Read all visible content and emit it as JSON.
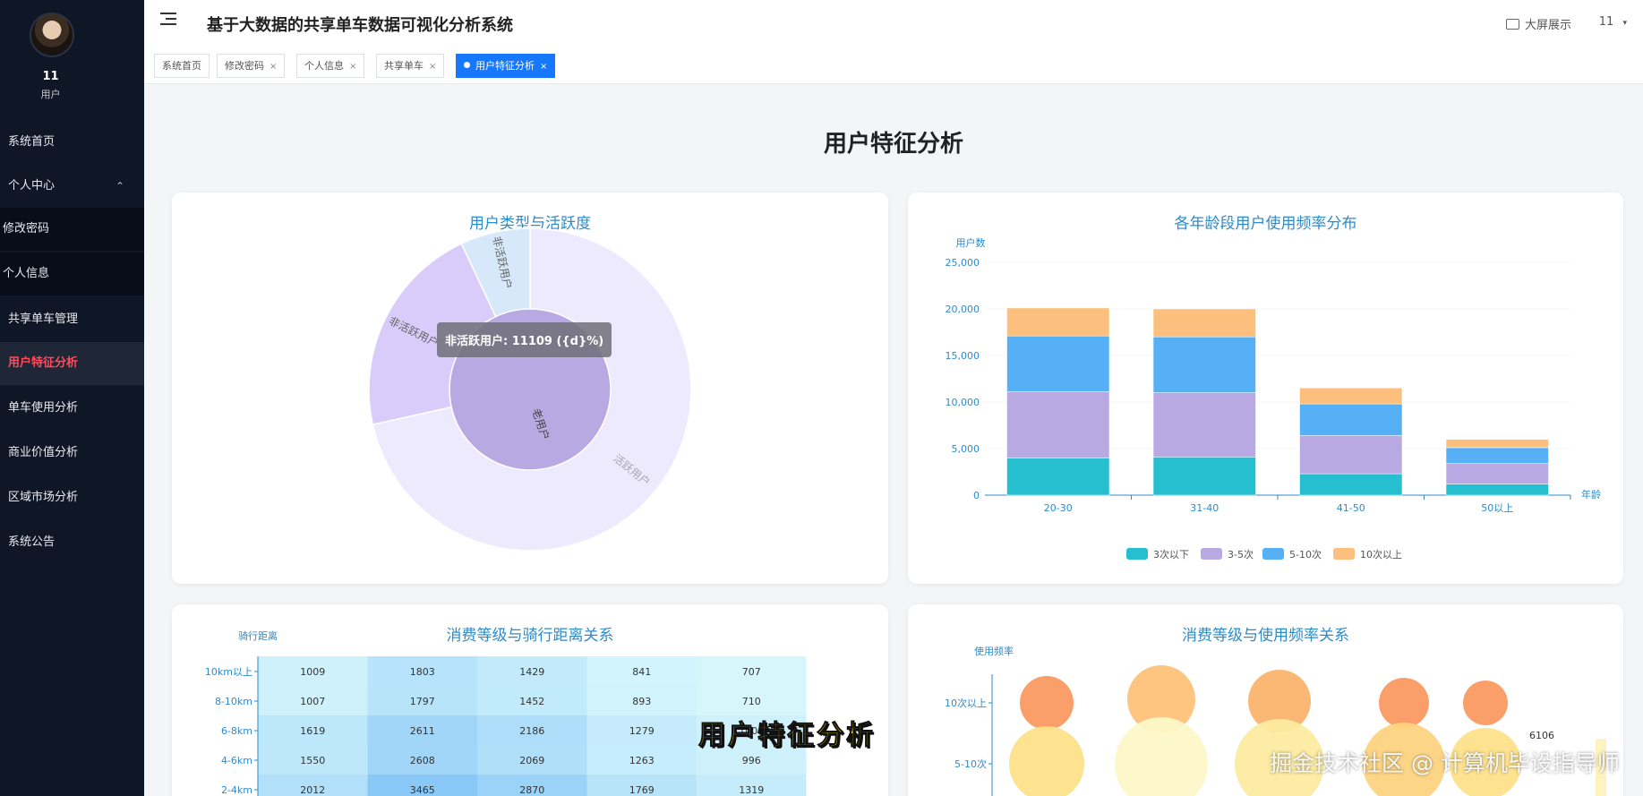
{
  "sidebar": {
    "user_name": "11",
    "user_role": "用户",
    "items": [
      {
        "label": "系统首页"
      },
      {
        "label": "个人中心"
      },
      {
        "label": "修改密码"
      },
      {
        "label": "个人信息"
      },
      {
        "label": "共享单车管理"
      },
      {
        "label": "用户特征分析"
      },
      {
        "label": "单车使用分析"
      },
      {
        "label": "商业价值分析"
      },
      {
        "label": "区域市场分析"
      },
      {
        "label": "系统公告"
      }
    ]
  },
  "header": {
    "title": "基于大数据的共享单车数据可视化分析系统",
    "bigscreen_label": "大屏展示",
    "user_label": "11",
    "tabs": [
      {
        "label": "系统首页"
      },
      {
        "label": "修改密码"
      },
      {
        "label": "个人信息"
      },
      {
        "label": "共享单车"
      },
      {
        "label": "用户特征分析"
      }
    ]
  },
  "main": {
    "heading": "用户特征分析",
    "caption": "用户特征分析",
    "watermark": "掘金技术社区 @ 计算机毕设指导师"
  },
  "colors": {
    "accent": "#1677ff",
    "sidebar_bg": "#0f1727",
    "active_nav": "#ff4b5c"
  },
  "chart_data": [
    {
      "type": "pie",
      "title": "用户类型与活跃度",
      "inner": [
        {
          "name": "老用户",
          "value": 1
        }
      ],
      "outer": [
        {
          "name": "活跃用户",
          "value": 0.715
        },
        {
          "name": "非活跃用户",
          "value": 0.215
        },
        {
          "name": "非活跃用户",
          "value": 0.07
        }
      ],
      "tooltip": "非活跃用户: 11109 ({d}%)"
    },
    {
      "type": "bar",
      "title": "各年龄段用户使用频率分布",
      "ylabel": "用户数",
      "xlabel": "年龄",
      "ylim": [
        0,
        25000
      ],
      "yticks": [
        "0",
        "5,000",
        "10,000",
        "15,000",
        "20,000",
        "25,000"
      ],
      "categories": [
        "20-30",
        "31-40",
        "41-50",
        "50以上"
      ],
      "series": [
        {
          "name": "3次以下",
          "color": "#26bfd0",
          "values": [
            4000,
            4100,
            2300,
            1200
          ]
        },
        {
          "name": "3-5次",
          "color": "#b8a9e3",
          "values": [
            7100,
            6900,
            4100,
            2200
          ]
        },
        {
          "name": "5-10次",
          "color": "#55b0f5",
          "values": [
            6000,
            6000,
            3400,
            1700
          ]
        },
        {
          "name": "10次以上",
          "color": "#fcbf7d",
          "values": [
            3000,
            3000,
            1700,
            900
          ]
        }
      ],
      "stacked": true,
      "legend": "bottom"
    },
    {
      "type": "heatmap",
      "title": "消费等级与骑行距离关系",
      "ylabel": "骑行距离",
      "rows": [
        "10km以上",
        "8-10km",
        "6-8km",
        "4-6km",
        "2-4km"
      ],
      "values": [
        [
          1009,
          1803,
          1429,
          841,
          707
        ],
        [
          1007,
          1797,
          1452,
          893,
          710
        ],
        [
          1619,
          2611,
          2186,
          1279,
          1000
        ],
        [
          1550,
          2608,
          2069,
          1263,
          996
        ],
        [
          2012,
          3465,
          2870,
          1769,
          1319
        ]
      ]
    },
    {
      "type": "scatter",
      "title": "消费等级与使用频率关系",
      "ylabel": "使用频率",
      "ycategories": [
        "10次以上",
        "5-10次"
      ],
      "visual_max_label": "6106"
    }
  ]
}
